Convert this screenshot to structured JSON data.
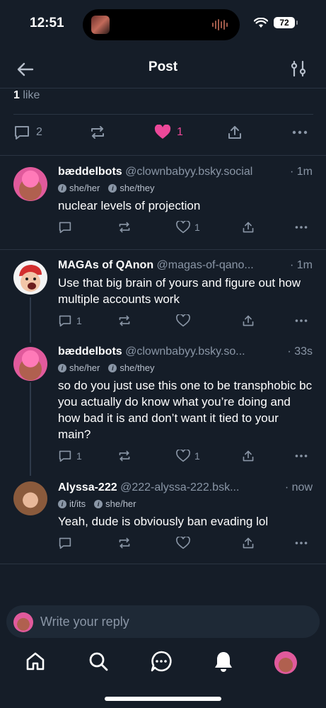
{
  "status": {
    "time": "12:51",
    "battery": "72"
  },
  "header": {
    "title": "Post"
  },
  "likes": {
    "count": "1",
    "label": "like"
  },
  "main_actions": {
    "replies": "2",
    "likes": "1",
    "like_color": "#ec4899"
  },
  "replies": [
    {
      "name": "bæddelbots",
      "handle": "@clownbabyy.bsky.social",
      "time": "· 1m",
      "pronouns": [
        "she/her",
        "she/they"
      ],
      "text": "nuclear levels of projection",
      "replies": "",
      "likes": "1"
    },
    {
      "name": "MAGAs of QAnon",
      "handle": "@magas-of-qano...",
      "time": "· 1m",
      "pronouns": [],
      "text": "Use that big brain of yours and figure out how multiple accounts work",
      "replies": "1",
      "likes": ""
    },
    {
      "name": "bæddelbots",
      "handle": "@clownbabyy.bsky.so...",
      "time": "· 33s",
      "pronouns": [
        "she/her",
        "she/they"
      ],
      "text": "so do you just use this one to be transphobic bc you actually do know what you’re doing and how bad it is and don’t want it tied to your main?",
      "replies": "1",
      "likes": "1"
    },
    {
      "name": "Alyssa-222",
      "handle": "@222-alyssa-222.bsk...",
      "time": "· now",
      "pronouns": [
        "it/its",
        "she/her"
      ],
      "text": "Yeah, dude is obviously ban evading lol",
      "replies": "",
      "likes": ""
    }
  ],
  "composer": {
    "placeholder": "Write your reply"
  },
  "icons": {
    "pronoun_icon": "i"
  }
}
